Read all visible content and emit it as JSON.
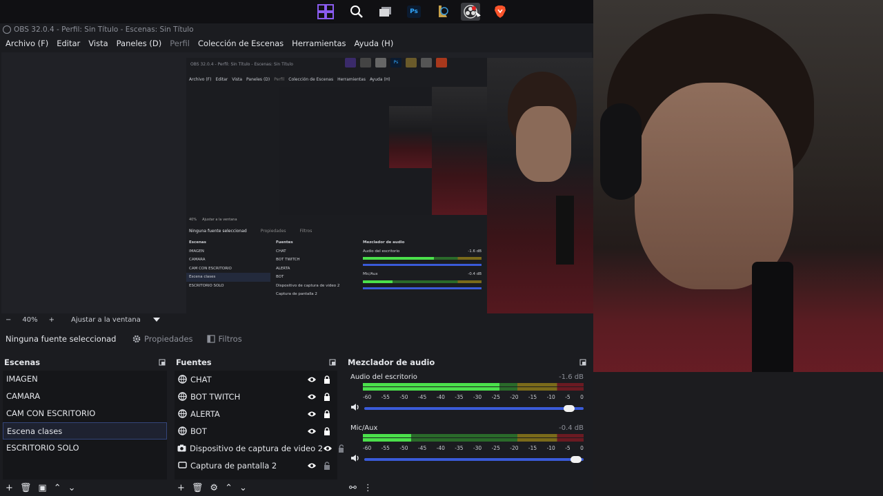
{
  "taskbar": {
    "icons": [
      "windows-start-icon",
      "search-icon",
      "task-view-icon",
      "photoshop-icon",
      "league-of-legends-icon",
      "obs-icon",
      "brave-icon"
    ],
    "photoshop_label": "Ps"
  },
  "window": {
    "title": "OBS 32.0.4 - Perfil: Sin Título - Escenas: Sin Título"
  },
  "menu": {
    "archivo": "Archivo (F)",
    "editar": "Editar",
    "vista": "Vista",
    "paneles": "Paneles (D)",
    "perfil": "Perfil",
    "coleccion": "Colección de Escenas",
    "herramientas": "Herramientas",
    "ayuda": "Ayuda (H)"
  },
  "zoom": {
    "minus": "−",
    "value": "40%",
    "plus": "+",
    "fit": "Ajustar a la ventana"
  },
  "selection": {
    "none": "Ninguna fuente seleccionad",
    "properties": "Propiedades",
    "filters": "Filtros"
  },
  "scenes": {
    "title": "Escenas",
    "items": [
      "IMAGEN",
      "CAMARA",
      "CAM CON ESCRITORIO",
      "Escena clases",
      "ESCRITORIO SOLO"
    ],
    "selected_index": 3
  },
  "sources": {
    "title": "Fuentes",
    "items": [
      {
        "name": "CHAT",
        "icon": "browser-icon"
      },
      {
        "name": "BOT TWITCH",
        "icon": "browser-icon"
      },
      {
        "name": "ALERTA",
        "icon": "browser-icon"
      },
      {
        "name": "BOT",
        "icon": "browser-icon"
      },
      {
        "name": "Dispositivo de captura de video 2",
        "icon": "camera-icon"
      },
      {
        "name": "Captura de pantalla 2",
        "icon": "monitor-icon"
      }
    ]
  },
  "mixer": {
    "title": "Mezclador de audio",
    "scale": [
      "-60",
      "-55",
      "-50",
      "-45",
      "-40",
      "-35",
      "-30",
      "-25",
      "-20",
      "-15",
      "-10",
      "-5",
      "0"
    ],
    "tracks": [
      {
        "name": "Audio del escritorio",
        "db": "-1.6 dB",
        "level": 0.62,
        "volume": 0.96
      },
      {
        "name": "Mic/Aux",
        "db": "-0.4 dB",
        "level": 0.22,
        "volume": 0.99
      }
    ]
  },
  "nested": {
    "title": "OBS 32.0.4 - Perfil: Sin Título - Escenas: Sin Título",
    "menu": [
      "Archivo (F)",
      "Editar",
      "Vista",
      "Paneles (D)",
      "Perfil",
      "Colección de Escenas",
      "Herramientas",
      "Ayuda (H)"
    ],
    "none": "Ninguna fuente seleccionad",
    "properties": "Propiedades",
    "filters": "Filtros",
    "scenes_title": "Escenas",
    "sources_title": "Fuentes",
    "mixer_title": "Mezclador de audio",
    "zoom": "40%",
    "fit": "Ajustar a la ventana",
    "track1": "Audio del escritorio",
    "track1_db": "-1.6 dB",
    "track2": "Mic/Aux",
    "track2_db": "-0.4 dB",
    "ps": "Ps"
  }
}
